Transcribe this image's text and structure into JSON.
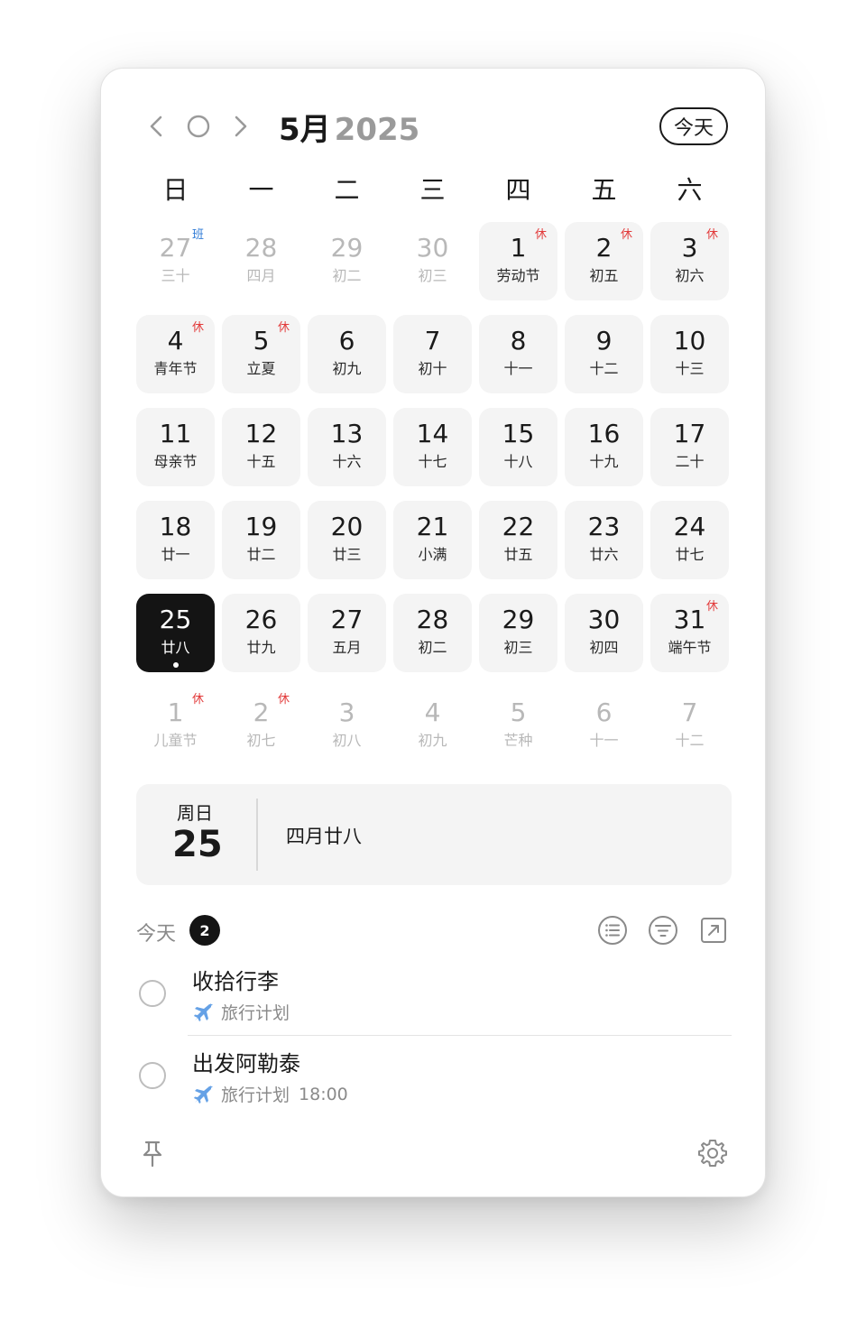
{
  "header": {
    "month": "5月",
    "year": "2025",
    "today_label": "今天",
    "icons": [
      "chevron-left-icon",
      "circle-icon",
      "chevron-right-icon"
    ]
  },
  "weekdays": [
    "日",
    "一",
    "二",
    "三",
    "四",
    "五",
    "六"
  ],
  "weeks": [
    [
      {
        "day": "27",
        "sub": "三十",
        "badge": "班",
        "type": "other"
      },
      {
        "day": "28",
        "sub": "四月",
        "badge": "",
        "type": "other"
      },
      {
        "day": "29",
        "sub": "初二",
        "badge": "",
        "type": "other"
      },
      {
        "day": "30",
        "sub": "初三",
        "badge": "",
        "type": "other"
      },
      {
        "day": "1",
        "sub": "劳动节",
        "badge": "休",
        "type": "cur"
      },
      {
        "day": "2",
        "sub": "初五",
        "badge": "休",
        "type": "cur"
      },
      {
        "day": "3",
        "sub": "初六",
        "badge": "休",
        "type": "cur"
      }
    ],
    [
      {
        "day": "4",
        "sub": "青年节",
        "badge": "休",
        "type": "cur"
      },
      {
        "day": "5",
        "sub": "立夏",
        "badge": "休",
        "type": "cur"
      },
      {
        "day": "6",
        "sub": "初九",
        "badge": "",
        "type": "cur"
      },
      {
        "day": "7",
        "sub": "初十",
        "badge": "",
        "type": "cur"
      },
      {
        "day": "8",
        "sub": "十一",
        "badge": "",
        "type": "cur"
      },
      {
        "day": "9",
        "sub": "十二",
        "badge": "",
        "type": "cur"
      },
      {
        "day": "10",
        "sub": "十三",
        "badge": "",
        "type": "cur"
      }
    ],
    [
      {
        "day": "11",
        "sub": "母亲节",
        "badge": "",
        "type": "cur"
      },
      {
        "day": "12",
        "sub": "十五",
        "badge": "",
        "type": "cur"
      },
      {
        "day": "13",
        "sub": "十六",
        "badge": "",
        "type": "cur"
      },
      {
        "day": "14",
        "sub": "十七",
        "badge": "",
        "type": "cur"
      },
      {
        "day": "15",
        "sub": "十八",
        "badge": "",
        "type": "cur"
      },
      {
        "day": "16",
        "sub": "十九",
        "badge": "",
        "type": "cur"
      },
      {
        "day": "17",
        "sub": "二十",
        "badge": "",
        "type": "cur"
      }
    ],
    [
      {
        "day": "18",
        "sub": "廿一",
        "badge": "",
        "type": "cur"
      },
      {
        "day": "19",
        "sub": "廿二",
        "badge": "",
        "type": "cur"
      },
      {
        "day": "20",
        "sub": "廿三",
        "badge": "",
        "type": "cur"
      },
      {
        "day": "21",
        "sub": "小满",
        "badge": "",
        "type": "cur"
      },
      {
        "day": "22",
        "sub": "廿五",
        "badge": "",
        "type": "cur"
      },
      {
        "day": "23",
        "sub": "廿六",
        "badge": "",
        "type": "cur"
      },
      {
        "day": "24",
        "sub": "廿七",
        "badge": "",
        "type": "cur"
      }
    ],
    [
      {
        "day": "25",
        "sub": "廿八",
        "badge": "",
        "type": "sel"
      },
      {
        "day": "26",
        "sub": "廿九",
        "badge": "",
        "type": "cur"
      },
      {
        "day": "27",
        "sub": "五月",
        "badge": "",
        "type": "cur"
      },
      {
        "day": "28",
        "sub": "初二",
        "badge": "",
        "type": "cur"
      },
      {
        "day": "29",
        "sub": "初三",
        "badge": "",
        "type": "cur"
      },
      {
        "day": "30",
        "sub": "初四",
        "badge": "",
        "type": "cur"
      },
      {
        "day": "31",
        "sub": "端午节",
        "badge": "休",
        "type": "cur"
      }
    ],
    [
      {
        "day": "1",
        "sub": "儿童节",
        "badge": "休",
        "type": "other"
      },
      {
        "day": "2",
        "sub": "初七",
        "badge": "休",
        "type": "other"
      },
      {
        "day": "3",
        "sub": "初八",
        "badge": "",
        "type": "other"
      },
      {
        "day": "4",
        "sub": "初九",
        "badge": "",
        "type": "other"
      },
      {
        "day": "5",
        "sub": "芒种",
        "badge": "",
        "type": "other"
      },
      {
        "day": "6",
        "sub": "十一",
        "badge": "",
        "type": "other"
      },
      {
        "day": "7",
        "sub": "十二",
        "badge": "",
        "type": "other"
      }
    ]
  ],
  "detail": {
    "weekday": "周日",
    "day": "25",
    "lunar": "四月廿八"
  },
  "todos": {
    "label": "今天",
    "count": "2",
    "tool_icons": [
      "list-icon",
      "filter-icon",
      "open-external-icon"
    ],
    "items": [
      {
        "title": "收拾行李",
        "list": "旅行计划",
        "time": "",
        "icon": "airplane-icon"
      },
      {
        "title": "出发阿勒泰",
        "list": "旅行计划",
        "time": "18:00",
        "icon": "airplane-icon"
      }
    ]
  },
  "footer": {
    "icons": [
      "pin-icon",
      "gear-icon"
    ]
  },
  "colors": {
    "holiday_badge": "#e23b3b",
    "work_badge": "#2f7bd6",
    "selected_bg": "#141414",
    "cell_bg": "#f4f4f4",
    "muted_text": "#b8b8b8",
    "airplane": "#4a90e2"
  }
}
